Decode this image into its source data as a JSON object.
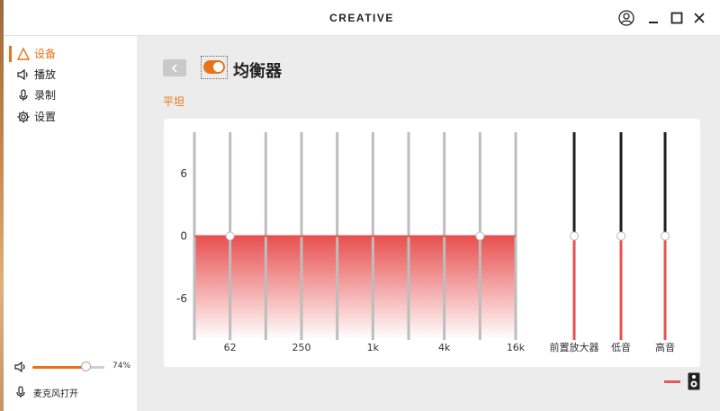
{
  "window": {
    "brand": "CREATIVE"
  },
  "sidebar": {
    "items": [
      {
        "label": "设备",
        "icon": "device-icon",
        "active": true
      },
      {
        "label": "播放",
        "icon": "speaker-icon",
        "active": false
      },
      {
        "label": "录制",
        "icon": "microphone-icon",
        "active": false
      },
      {
        "label": "设置",
        "icon": "gear-icon",
        "active": false
      }
    ],
    "volume": {
      "value": 74,
      "label": "74%"
    },
    "mic_status": "麦克风打开"
  },
  "main": {
    "title": "均衡器",
    "enabled": true,
    "preset": "平坦"
  },
  "equalizer": {
    "y_ticks": [
      "6",
      "0",
      "-6"
    ],
    "band_labels": [
      "62",
      "250",
      "1k",
      "4k",
      "16k"
    ],
    "band_gains": [
      0,
      0,
      0,
      0,
      0,
      0,
      0,
      0,
      0,
      0
    ],
    "ylim": [
      -10,
      10
    ],
    "extra_sliders": [
      {
        "label": "前置放大器",
        "value": 0
      },
      {
        "label": "低音",
        "value": 0
      },
      {
        "label": "高音",
        "value": 0
      }
    ]
  },
  "colors": {
    "accent": "#e8731a",
    "eq_fill": "#e85050"
  }
}
